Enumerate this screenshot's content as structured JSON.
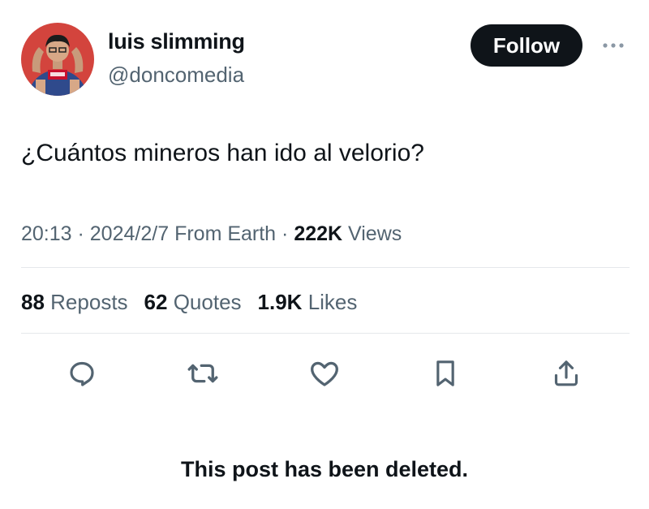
{
  "author": {
    "display_name": "luis slimming",
    "handle": "@doncomedia",
    "avatar_icon": "avatar-photo",
    "follow_label": "Follow",
    "more_icon": "more-icon"
  },
  "post": {
    "text": "¿Cuántos mineros han ido al velorio?",
    "time": "20:13",
    "date": "2024/2/7",
    "source": "From Earth",
    "views_count": "222K",
    "views_label": "Views"
  },
  "stats": {
    "reposts_count": "88",
    "reposts_label": "Reposts",
    "quotes_count": "62",
    "quotes_label": "Quotes",
    "likes_count": "1.9K",
    "likes_label": "Likes"
  },
  "actions": [
    "reply-icon",
    "repost-icon",
    "like-icon",
    "bookmark-icon",
    "share-icon"
  ],
  "notice": "This post has been deleted.",
  "colors": {
    "text": "#0f1419",
    "secondary": "#536471",
    "divider": "#e5e8eb",
    "button": "#0f1419"
  }
}
